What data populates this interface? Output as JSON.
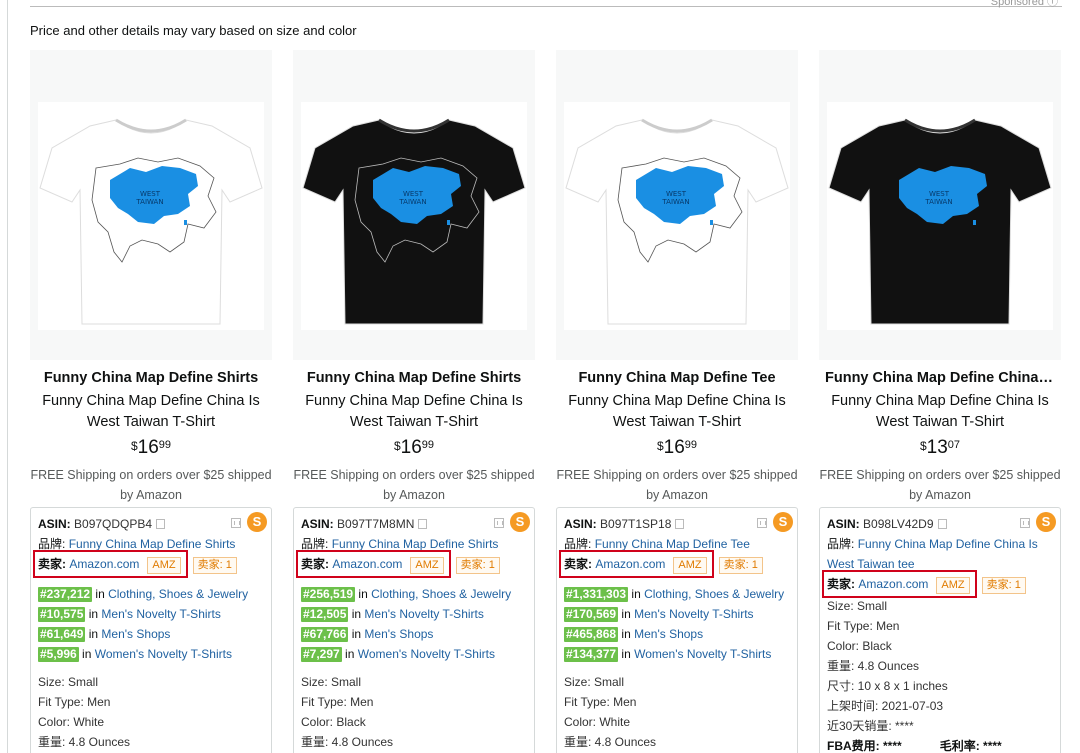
{
  "header": {
    "sponsored": "Sponsored ⓘ",
    "note": "Price and other details may vary based on size and color"
  },
  "labels": {
    "asin": "ASIN:",
    "brand": "品牌:",
    "seller": "卖家:",
    "in": "in"
  },
  "colors": {
    "shirt_white": "#ffffff",
    "shirt_black": "#111111",
    "map_blue": "#1a8fe3",
    "rank_green": "#6cc04a",
    "highlight_red": "#d0021b",
    "accent_orange": "#f59a23",
    "link_blue": "#2162a1"
  },
  "products": [
    {
      "shirt_color": "white",
      "title_bold": "Funny China Map Define Shirts",
      "title_line1": "Funny China Map Define China Is",
      "title_line2": "West Taiwan T-Shirt",
      "price_symbol": "$",
      "price_whole": "16",
      "price_fraction": "99",
      "shipping_line1": "FREE Shipping on orders over $25 shipped",
      "shipping_line2": "by Amazon",
      "asin": "B097QDQPB4",
      "brand": "Funny China Map Define Shirts",
      "seller": "Amazon.com",
      "amz_tag": "AMZ",
      "seller_count": "卖家: 1",
      "ranks": [
        {
          "rank": "#237,212",
          "category": "Clothing, Shoes & Jewelry"
        },
        {
          "rank": "#10,575",
          "category": "Men's Novelty T-Shirts"
        },
        {
          "rank": "#61,649",
          "category": "Men's Shops"
        },
        {
          "rank": "#5,996",
          "category": "Women's Novelty T-Shirts"
        }
      ],
      "details": [
        "Size: Small",
        "Fit Type: Men",
        "Color: White",
        "重量: 4.8 Ounces"
      ]
    },
    {
      "shirt_color": "black",
      "title_bold": "Funny China Map Define Shirts",
      "title_line1": "Funny China Map Define China Is",
      "title_line2": "West Taiwan T-Shirt",
      "price_symbol": "$",
      "price_whole": "16",
      "price_fraction": "99",
      "shipping_line1": "FREE Shipping on orders over $25 shipped",
      "shipping_line2": "by Amazon",
      "asin": "B097T7M8MN",
      "brand": "Funny China Map Define Shirts",
      "seller": "Amazon.com",
      "amz_tag": "AMZ",
      "seller_count": "卖家: 1",
      "ranks": [
        {
          "rank": "#256,519",
          "category": "Clothing, Shoes & Jewelry"
        },
        {
          "rank": "#12,505",
          "category": "Men's Novelty T-Shirts"
        },
        {
          "rank": "#67,766",
          "category": "Men's Shops"
        },
        {
          "rank": "#7,297",
          "category": "Women's Novelty T-Shirts"
        }
      ],
      "details": [
        "Size: Small",
        "Fit Type: Men",
        "Color: Black",
        "重量: 4.8 Ounces"
      ]
    },
    {
      "shirt_color": "white",
      "title_bold": "Funny China Map Define Tee",
      "title_line1": "Funny China Map Define China Is",
      "title_line2": "West Taiwan T-Shirt",
      "price_symbol": "$",
      "price_whole": "16",
      "price_fraction": "99",
      "shipping_line1": "FREE Shipping on orders over $25 shipped",
      "shipping_line2": "by Amazon",
      "asin": "B097T1SP18",
      "brand": "Funny China Map Define Tee",
      "seller": "Amazon.com",
      "amz_tag": "AMZ",
      "seller_count": "卖家: 1",
      "ranks": [
        {
          "rank": "#1,331,303",
          "category": "Clothing, Shoes & Jewelry"
        },
        {
          "rank": "#170,569",
          "category": "Men's Novelty T-Shirts"
        },
        {
          "rank": "#465,868",
          "category": "Men's Shops"
        },
        {
          "rank": "#134,377",
          "category": "Women's Novelty T-Shirts"
        }
      ],
      "details": [
        "Size: Small",
        "Fit Type: Men",
        "Color: White",
        "重量: 4.8 Ounces"
      ]
    },
    {
      "shirt_color": "black",
      "title_bold": "Funny China Map Define China I...",
      "title_line1": "Funny China Map Define China Is",
      "title_line2": "West Taiwan T-Shirt",
      "price_symbol": "$",
      "price_whole": "13",
      "price_fraction": "07",
      "shipping_line1": "FREE Shipping on orders over $25 shipped",
      "shipping_line2": "by Amazon",
      "asin": "B098LV42D9",
      "brand_line1": "Funny China Map Define China Is",
      "brand_line2": "West Taiwan tee",
      "seller": "Amazon.com",
      "amz_tag": "AMZ",
      "seller_count": "卖家: 1",
      "details": [
        "Size: Small",
        "Fit Type: Men",
        "Color: Black",
        "重量: 4.8 Ounces",
        "尺寸: 10 x 8 x 1 inches",
        "上架时间: 2021-07-03",
        "近30天销量: ****"
      ],
      "fba_label": "FBA费用: ****",
      "margin_label": "毛利率: ****"
    }
  ]
}
